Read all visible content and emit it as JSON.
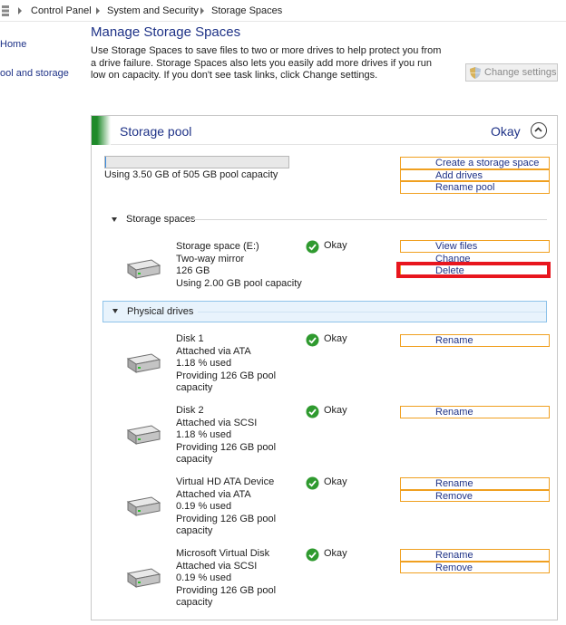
{
  "breadcrumb": [
    "Control Panel",
    "System and Security",
    "Storage Spaces"
  ],
  "left_nav": [
    "Home",
    "ool and storage"
  ],
  "header": {
    "title": "Manage Storage Spaces",
    "intro": "Use Storage Spaces to save files to two or more drives to help protect you from a drive failure. Storage Spaces also lets you easily add more drives if you run low on capacity. If you don't see task links, click Change settings.",
    "change_settings": "Change settings"
  },
  "pool": {
    "title": "Storage pool",
    "status": "Okay",
    "capacity_text": "Using 3.50 GB of 505 GB pool capacity",
    "capacity_used_fraction": 0.007,
    "tasks": [
      "Create a storage space",
      "Add drives",
      "Rename pool"
    ]
  },
  "storage_spaces": {
    "heading": "Storage spaces",
    "items": [
      {
        "lines": [
          "Storage space (E:)",
          "Two-way mirror",
          "126 GB",
          "Using 2.00 GB pool capacity"
        ],
        "status": "Okay",
        "actions": [
          "View files",
          "Change",
          "Delete"
        ]
      }
    ]
  },
  "physical_drives": {
    "heading": "Physical drives",
    "items": [
      {
        "lines": [
          "Disk 1",
          "Attached via ATA",
          "1.18 % used",
          "Providing 126 GB pool",
          "capacity"
        ],
        "status": "Okay",
        "actions": [
          "Rename"
        ]
      },
      {
        "lines": [
          "Disk 2",
          "Attached via SCSI",
          "1.18 % used",
          "Providing 126 GB pool",
          "capacity"
        ],
        "status": "Okay",
        "actions": [
          "Rename"
        ]
      },
      {
        "lines": [
          "Virtual HD ATA Device",
          "Attached via ATA",
          "0.19 % used",
          "Providing 126 GB pool",
          "capacity"
        ],
        "status": "Okay",
        "actions": [
          "Rename",
          "Remove"
        ]
      },
      {
        "lines": [
          "Microsoft Virtual Disk",
          "Attached via SCSI",
          "0.19 % used",
          "Providing 126 GB pool",
          "capacity"
        ],
        "status": "Okay",
        "actions": [
          "Rename",
          "Remove"
        ]
      }
    ]
  },
  "colors": {
    "link": "#1e3287",
    "task_border": "#f0a020",
    "highlight": "#e8161e",
    "ok_green": "#2f9a2f",
    "accent_green": "#1f8a2a"
  },
  "icons": {
    "breadcrumb": "control-panel-icon",
    "drive": "hard-drive-icon",
    "status": "check-circle-icon",
    "settings": "uac-shield-icon",
    "collapse": "chevron-up-icon"
  }
}
